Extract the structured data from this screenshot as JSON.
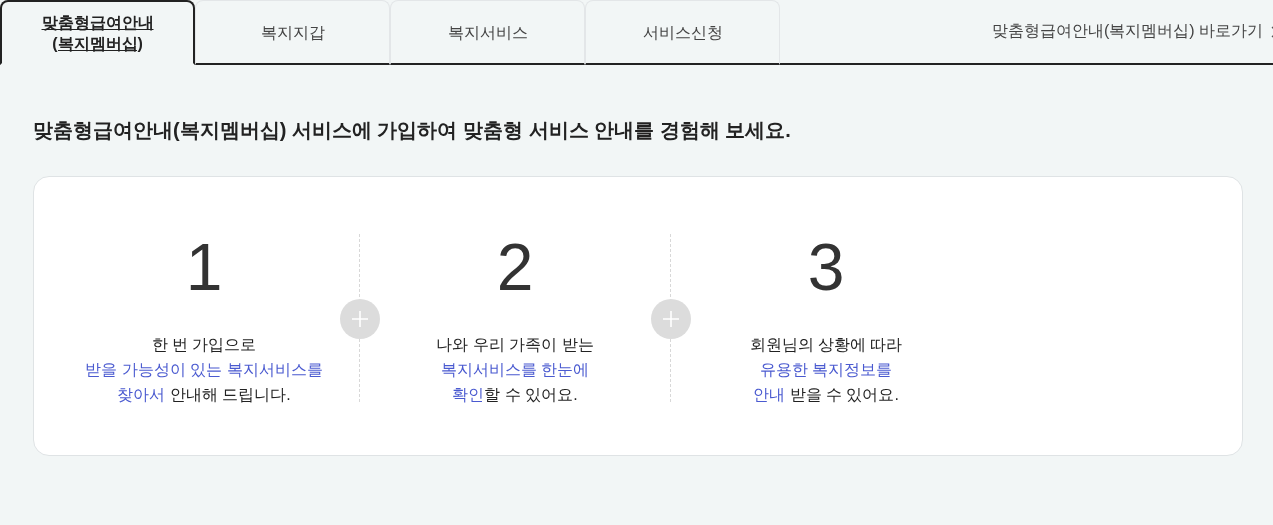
{
  "tabs": [
    {
      "label": "맞춤형급여안내",
      "label_line2": "(복지멤버십)",
      "selected": true
    },
    {
      "label": "복지지갑",
      "selected": false
    },
    {
      "label": "복지서비스",
      "selected": false
    },
    {
      "label": "서비스신청",
      "selected": false
    }
  ],
  "shortcut_link": {
    "label": "맞춤형급여안내(복지멤버십) 바로가기"
  },
  "heading": "맞춤형급여안내(복지멤버십) 서비스에 가입하여 맞춤형 서비스 안내를 경험해 보세요.",
  "steps": [
    {
      "number": "1",
      "intro": "한 번 가입으로",
      "highlight_line": "받을 가능성이 있는 복지서비스를",
      "highlight_end": "찾아서",
      "outro": " 안내해 드립니다."
    },
    {
      "number": "2",
      "intro": "나와 우리 가족이 받는",
      "highlight_line": "복지서비스를 한눈에",
      "highlight_end": "확인",
      "outro": "할 수 있어요."
    },
    {
      "number": "3",
      "intro": "회원님의 상황에 따라",
      "highlight_line": "유용한 복지정보를",
      "highlight_end": "안내",
      "outro": " 받을 수 있어요."
    }
  ]
}
